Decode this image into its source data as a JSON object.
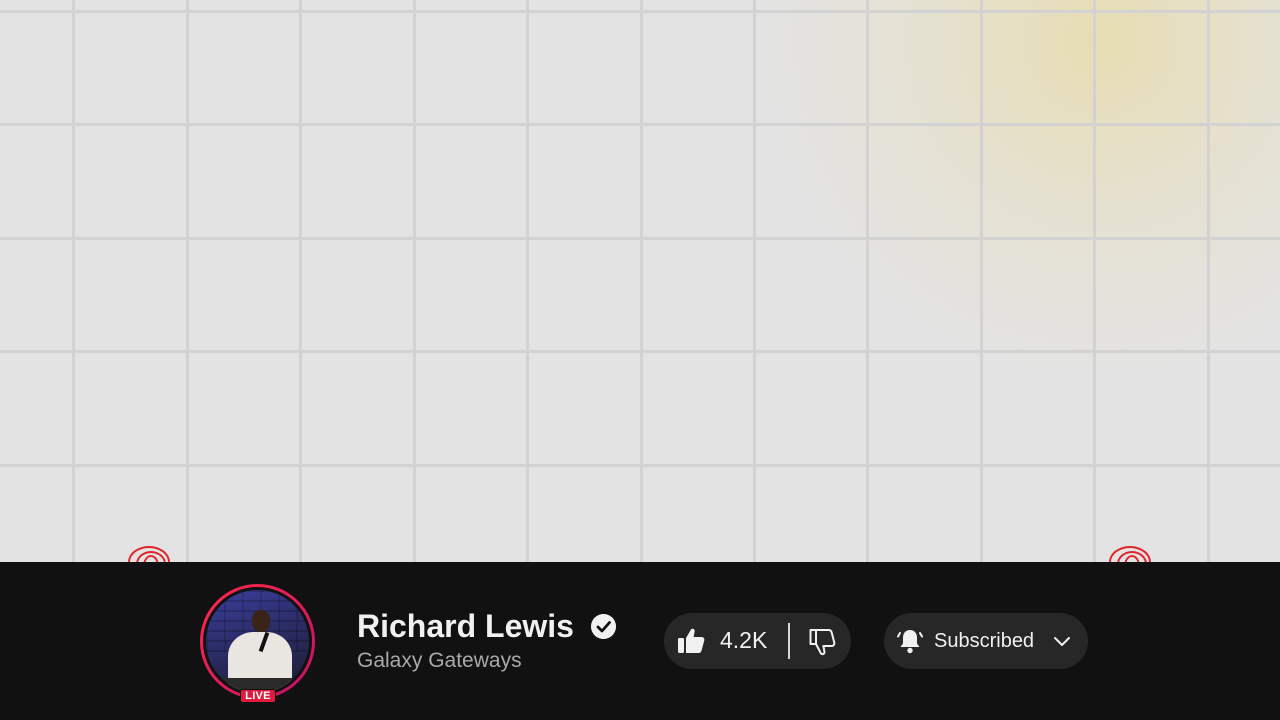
{
  "channel": {
    "name": "Richard Lewis",
    "subtitle": "Galaxy Gateways",
    "verified": true,
    "live_badge": "LIVE"
  },
  "actions": {
    "like_count": "4.2K",
    "subscribe_label": "Subscribed"
  },
  "icons": {
    "like": "thumb-up-icon",
    "dislike": "thumb-down-icon",
    "notifications": "bell-icon",
    "menu": "chevron-down-icon",
    "verified": "checkmark-badge-icon"
  },
  "colors": {
    "bar_background": "#111111",
    "pill_background": "#272727",
    "live_red": "#e01a3c",
    "text_primary": "#f1f1f1",
    "text_secondary": "#a9a9a9"
  }
}
